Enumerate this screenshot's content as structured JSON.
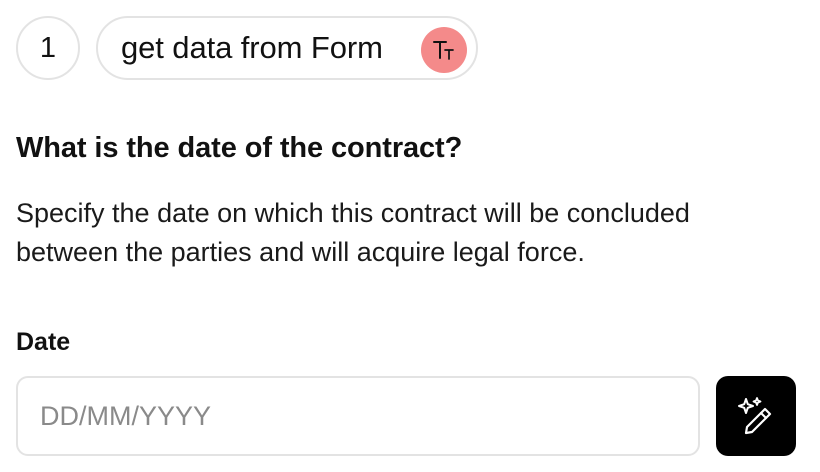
{
  "step": {
    "number": "1",
    "label": "get data from Form",
    "type_icon": "text-type-icon"
  },
  "question": {
    "title": "What is the date of the contract?",
    "description": "Specify the date on which this contract will be concluded between the parties and will acquire legal force."
  },
  "field": {
    "label": "Date",
    "value": "",
    "placeholder": "DD/MM/YYYY"
  },
  "actions": {
    "magic_icon": "magic-wand-icon"
  },
  "colors": {
    "badge": "#f48a8a",
    "button": "#000000",
    "border": "#e3e3e3",
    "placeholder": "#8a8a8a"
  }
}
